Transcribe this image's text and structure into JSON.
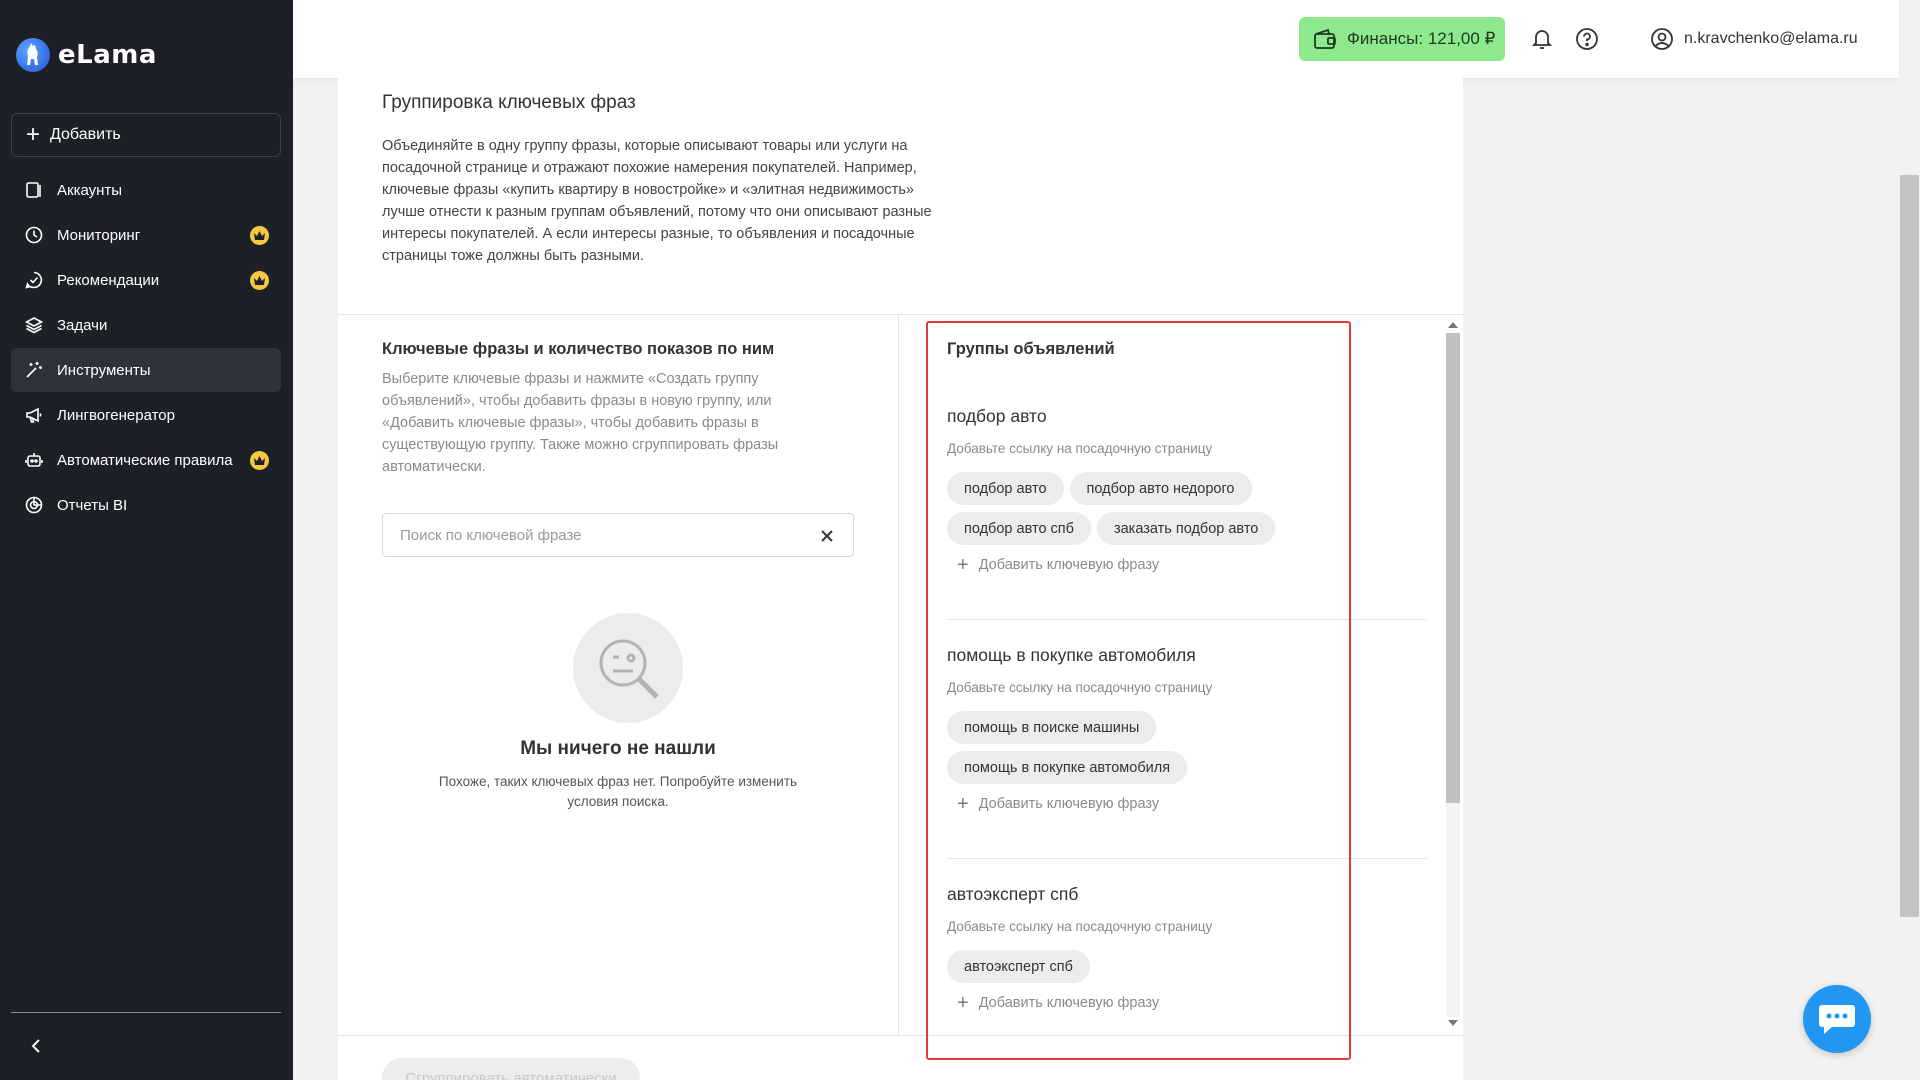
{
  "sidebar": {
    "logo_text": "eLama",
    "add_label": "Добавить",
    "items": [
      {
        "label": "Аккаунты",
        "icon": "accounts-icon",
        "premium": false,
        "active": false
      },
      {
        "label": "Мониторинг",
        "icon": "clock-icon",
        "premium": true,
        "active": false
      },
      {
        "label": "Рекомендации",
        "icon": "check-bubble-icon",
        "premium": true,
        "active": false
      },
      {
        "label": "Задачи",
        "icon": "layers-icon",
        "premium": false,
        "active": false
      },
      {
        "label": "Инструменты",
        "icon": "magic-wand-icon",
        "premium": false,
        "active": true
      },
      {
        "label": "Лингвогенератор",
        "icon": "megaphone-icon",
        "premium": false,
        "active": false
      },
      {
        "label": "Автоматические правила",
        "icon": "robot-icon",
        "premium": true,
        "active": false
      },
      {
        "label": "Отчеты BI",
        "icon": "pie-chart-icon",
        "premium": false,
        "active": false
      }
    ]
  },
  "header": {
    "finance_label": "Финансы: 121,00 ₽",
    "user_email": "n.kravchenko@elama.ru"
  },
  "section": {
    "title": "Группировка ключевых фраз",
    "description": "Объединяйте в одну группу фразы, которые описывают товары или услуги на посадочной странице и отражают похожие намерения покупателей. Например, ключевые фразы «купить квартиру в новостройке» и «элитная недвижимость» лучше отнести к разным группам объявлений, потому что они описывают разные интересы покупателей. А если интересы разные, то объявления и посадочные страницы тоже должны быть разными."
  },
  "left": {
    "title": "Ключевые фразы и количество показов по ним",
    "description": "Выберите ключевые фразы и нажмите «Создать группу объявлений», чтобы добавить фразы в новую группу, или «Добавить ключевые фразы», чтобы добавить фразы в существующую группу. Также можно сгруппировать фразы автоматически.",
    "search_placeholder": "Поиск по ключевой фразе",
    "empty_title": "Мы ничего не нашли",
    "empty_desc": "Похоже, таких ключевых фраз нет. Попробуйте изменить условия поиска.",
    "bottom_button": "Сгруппировать автоматически"
  },
  "right": {
    "title": "Группы объявлений",
    "groups": [
      {
        "name": "подбор авто",
        "link_label": "Добавьте ссылку на посадочную страницу",
        "phrases": [
          "подбор авто",
          "подбор авто недорого",
          "подбор авто спб",
          "заказать подбор авто"
        ],
        "add_label": "Добавить ключевую фразу"
      },
      {
        "name": "помощь в покупке автомобиля",
        "link_label": "Добавьте ссылку на посадочную страницу",
        "phrases": [
          "помощь в поиске машины",
          "помощь в покупке автомобиля"
        ],
        "add_label": "Добавить ключевую фразу"
      },
      {
        "name": "автоэксперт спб",
        "link_label": "Добавьте ссылку на посадочную страницу",
        "phrases": [
          "автоэксперт спб"
        ],
        "add_label": "Добавить ключевую фразу"
      }
    ]
  },
  "colors": {
    "sidebar_bg": "#1d2027",
    "finance_bg": "#8ee88e",
    "premium_crown": "#f5c842",
    "highlight": "#e03a3a",
    "chat": "#2196f3"
  }
}
